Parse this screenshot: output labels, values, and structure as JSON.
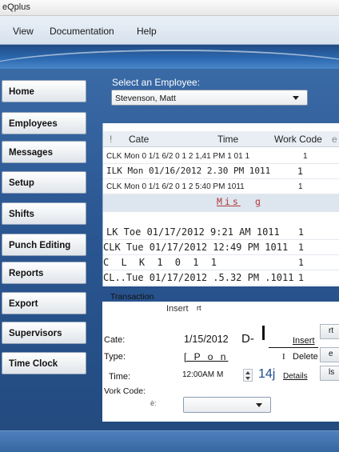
{
  "window": {
    "title": "eQplus"
  },
  "menu": [
    "View",
    "Documentation",
    "Help"
  ],
  "nav": [
    {
      "label": "Home"
    },
    {
      "label": "Employees"
    },
    {
      "label": "Messages"
    },
    {
      "label": "Setup"
    },
    {
      "label": "Shifts"
    },
    {
      "label": "Punch Editing"
    },
    {
      "label": "Reports"
    },
    {
      "label": "Export"
    },
    {
      "label": "Supervisors"
    },
    {
      "label": "Time Clock"
    }
  ],
  "employee_select": {
    "label": "Select an Employee:",
    "value": "Stevenson, Matt"
  },
  "grid": {
    "headers": {
      "c0": "!",
      "c1": "Cate",
      "c2": "Time",
      "c3": "Work Code",
      "c4": "e"
    },
    "rows": [
      {
        "text": "CLK Mon 0 1/1 6/2 0 1 2 1,41 PM 1 01 1",
        "tail": "1"
      },
      {
        "text": "ILK Mon 01/16/2012 2.30 PM 1011",
        "tail": "1"
      },
      {
        "text": "CLK Mon 0 1/1 6/2 0 1 2 5:40 PM 1011",
        "tail": "1"
      },
      {
        "text": "Mis",
        "tail": "g"
      },
      {
        "text": "LK Toe 01/17/2012 9:21 AM 1011",
        "tail": "1"
      },
      {
        "text": "CLK Tue 01/17/2012 12:49 PM 1011",
        "tail": "1"
      },
      {
        "text": "C L K 1 0 1 1",
        "tail": "1"
      },
      {
        "text": "CL..Tue 01/17/2012 .5.32 PM .1011",
        "tail": "1"
      }
    ]
  },
  "transaction": {
    "section_label": "Transaction",
    "insert_label": "Insert",
    "insert_suffix": "rt",
    "date_label": "Cate:",
    "date_value": "1/15/2012",
    "date_suffix": "D-",
    "insert_link": "Insert",
    "type_label": "Type:",
    "type_value": "[ P o n",
    "type_i": "I",
    "delete_link": "Delete",
    "time_label": "Time:",
    "time_value": "12:00AM",
    "time_m": "M",
    "time_extra": "14j",
    "details_link": "Details",
    "workcode_label": "Vork Code:",
    "workcode_suffix": "è:",
    "side_btn_1": "rt",
    "side_btn_2": "e",
    "side_btn_3": "ls"
  }
}
